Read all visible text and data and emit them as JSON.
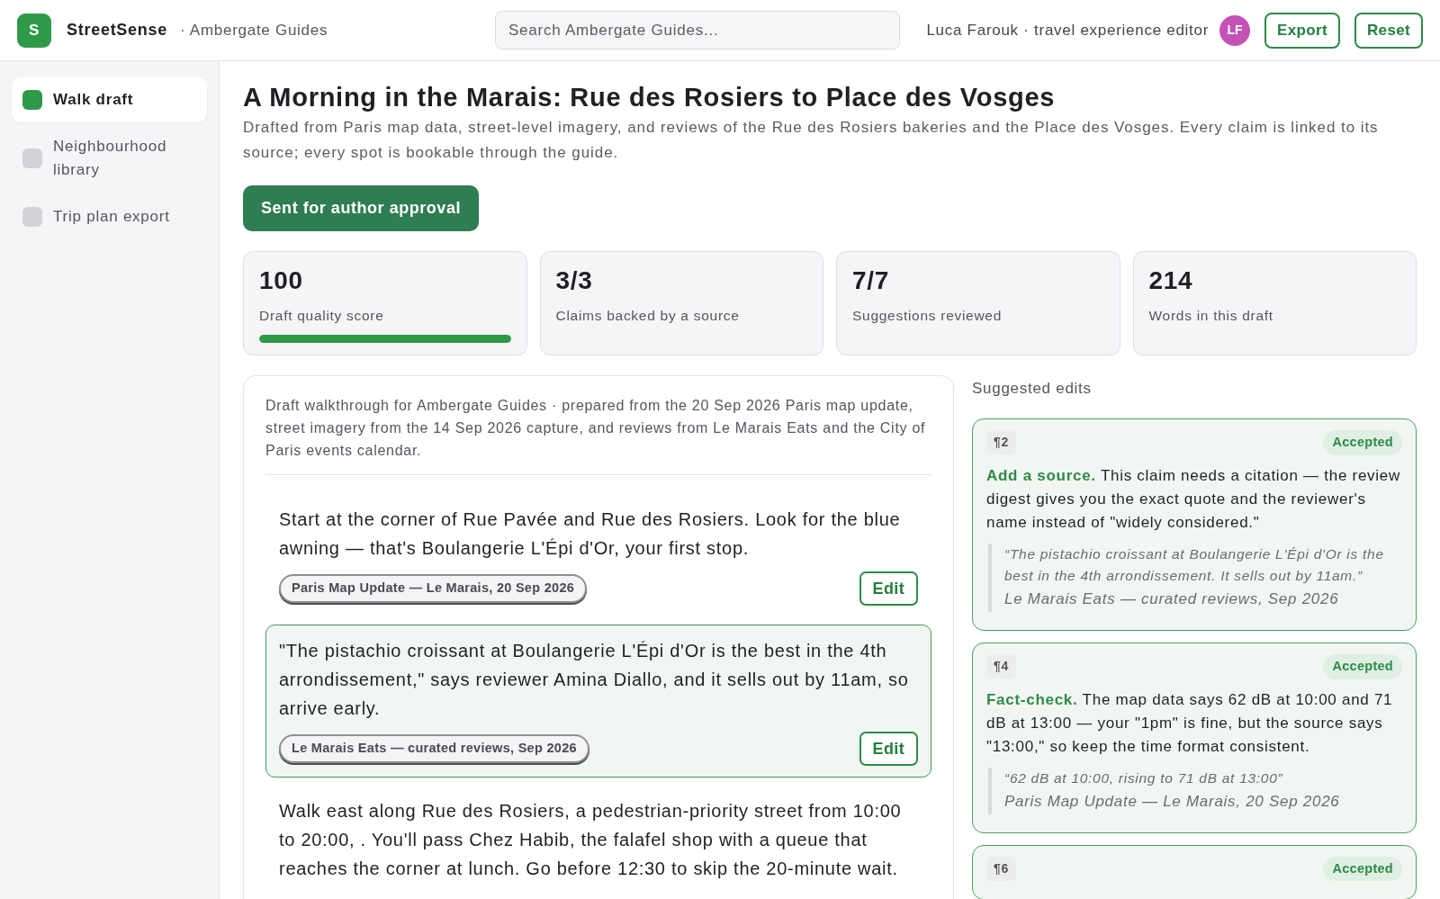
{
  "topbar": {
    "logo": "S",
    "brand": "StreetSense",
    "workspace": "· Ambergate Guides",
    "search": {
      "placeholder": "Search Ambergate Guides..."
    },
    "user": "Luca Farouk · travel experience editor",
    "avatar": "LF",
    "buttons": [
      "Export",
      "Reset"
    ]
  },
  "sidebar": {
    "items": [
      {
        "label": "Walk draft",
        "selected": true
      },
      {
        "label": "Neighbourhood library",
        "selected": false
      },
      {
        "label": "Trip plan export",
        "selected": false
      }
    ]
  },
  "header": {
    "title": "A Morning in the Marais: Rue des Rosiers to Place des Vosges",
    "subtitle": "Drafted from Paris map data, street-level imagery, and reviews of the Rue des Rosiers bakeries and the Place des Vosges. Every claim is linked to its source; every spot is bookable through the guide.",
    "status_button": "Sent for author approval"
  },
  "stats": [
    {
      "value": "100",
      "label": "Draft quality score",
      "level": 1.0
    },
    {
      "value": "3/3",
      "label": "Claims backed by a source"
    },
    {
      "value": "7/7",
      "label": "Suggestions reviewed"
    },
    {
      "value": "214",
      "label": "Words in this draft"
    }
  ],
  "draft": {
    "intro": "Draft walkthrough for Ambergate Guides · prepared from the 20 Sep 2026 Paris map update, street imagery from the 14 Sep 2026 capture, and reviews from Le Marais Eats and the City of Paris events calendar.",
    "paragraphs": [
      {
        "text": "Start at the corner of Rue Pavée and Rue des Rosiers. Look for the blue awning — that's Boulangerie L'Épi d'Or, your first stop.",
        "source": "Paris Map Update — Le Marais, 20 Sep 2026",
        "edit": "Edit",
        "highlighted": false
      },
      {
        "text": "\"The pistachio croissant at Boulangerie L'Épi d'Or is the best in the 4th arrondissement,\" says reviewer Amina Diallo, and it sells out by 11am, so arrive early.",
        "source": "Le Marais Eats — curated reviews, Sep 2026",
        "edit": "Edit",
        "highlighted": true
      },
      {
        "text": "Walk east along Rue des Rosiers, a pedestrian-priority street from 10:00 to 20:00, . You'll pass Chez Habib, the falafel shop with a queue that reaches the corner at lunch. Go before 12:30 to skip the 20-minute wait.",
        "highlighted": false
      }
    ]
  },
  "suggestions": {
    "title": "Suggested edits",
    "items": [
      {
        "paragraph": "¶2",
        "status": "Accepted",
        "body": "**Add a source.** This claim needs a citation — the review digest gives you the exact quote and the reviewer's name instead of \"widely considered.\"",
        "quote": "“The pistachio croissant at Boulangerie L'Épi d'Or is the best in the 4th arrondissement. It sells out by 11am.”",
        "source": "Le Marais Eats — curated reviews, Sep 2026"
      },
      {
        "paragraph": "¶4",
        "status": "Accepted",
        "body": "**Fact-check.** The map data says 62 dB at 10:00 and 71 dB at 13:00 — your \"1pm\" is fine, but the source says \"13:00,\" so keep the time format consistent.",
        "quote": "“62 dB at 10:00, rising to 71 dB at 13:00”",
        "source": "Paris Map Update — Le Marais, 20 Sep 2026"
      },
      {
        "paragraph": "¶6",
        "status": "Accepted"
      }
    ]
  }
}
